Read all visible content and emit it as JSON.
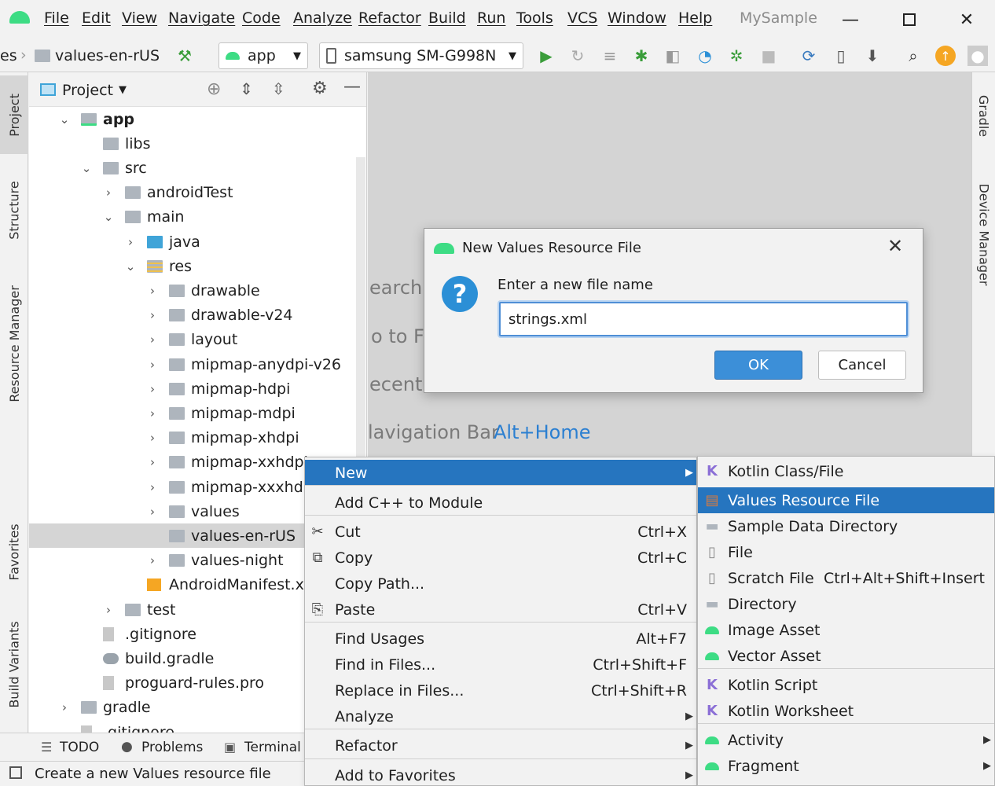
{
  "menu": [
    "File",
    "Edit",
    "View",
    "Navigate",
    "Code",
    "Analyze",
    "Refactor",
    "Build",
    "Run",
    "Tools",
    "VCS",
    "Window",
    "Help"
  ],
  "window_title": "MySample",
  "toolbar": {
    "breadcrumb_prefix": "es",
    "breadcrumb_folder": "values-en-rUS",
    "run_config": "app",
    "device": "samsung SM-G998N"
  },
  "left_tabs": [
    "Project",
    "Structure",
    "Resource Manager",
    "Favorites",
    "Build Variants"
  ],
  "right_tabs": [
    "Gradle",
    "Device Manager"
  ],
  "project_panel": {
    "title": "Project",
    "tree": [
      {
        "label": "app",
        "bold": true
      },
      {
        "label": "libs"
      },
      {
        "label": "src"
      },
      {
        "label": "androidTest"
      },
      {
        "label": "main"
      },
      {
        "label": "java"
      },
      {
        "label": "res"
      },
      {
        "label": "drawable"
      },
      {
        "label": "drawable-v24"
      },
      {
        "label": "layout"
      },
      {
        "label": "mipmap-anydpi-v26"
      },
      {
        "label": "mipmap-hdpi"
      },
      {
        "label": "mipmap-mdpi"
      },
      {
        "label": "mipmap-xhdpi"
      },
      {
        "label": "mipmap-xxhdpi"
      },
      {
        "label": "mipmap-xxxhdpi"
      },
      {
        "label": "values"
      },
      {
        "label": "values-en-rUS"
      },
      {
        "label": "values-night"
      },
      {
        "label": "AndroidManifest.xml"
      },
      {
        "label": "test"
      },
      {
        "label": ".gitignore"
      },
      {
        "label": "build.gradle"
      },
      {
        "label": "proguard-rules.pro"
      },
      {
        "label": "gradle"
      },
      {
        "label": ".gitignore"
      }
    ]
  },
  "editor_hints": [
    "earch",
    "o to F",
    "ecent",
    "lavigation Bar",
    "Alt+Home"
  ],
  "bottom_tools": [
    "TODO",
    "Problems",
    "Terminal"
  ],
  "status_text": "Create a new Values resource file",
  "dialog": {
    "title": "New Values Resource File",
    "prompt": "Enter a new file name",
    "input_value": "strings.xml",
    "ok": "OK",
    "cancel": "Cancel"
  },
  "context_menu": [
    {
      "label": "New",
      "shortcut": "",
      "submenu": true
    },
    {
      "label": "Add C++ to Module",
      "shortcut": ""
    },
    {
      "label": "Cut",
      "shortcut": "Ctrl+X"
    },
    {
      "label": "Copy",
      "shortcut": "Ctrl+C"
    },
    {
      "label": "Copy Path...",
      "shortcut": ""
    },
    {
      "label": "Paste",
      "shortcut": "Ctrl+V"
    },
    {
      "label": "Find Usages",
      "shortcut": "Alt+F7"
    },
    {
      "label": "Find in Files...",
      "shortcut": "Ctrl+Shift+F"
    },
    {
      "label": "Replace in Files...",
      "shortcut": "Ctrl+Shift+R"
    },
    {
      "label": "Analyze",
      "shortcut": "",
      "submenu": true
    },
    {
      "label": "Refactor",
      "shortcut": "",
      "submenu": true
    },
    {
      "label": "Add to Favorites",
      "shortcut": "",
      "submenu": true
    }
  ],
  "new_submenu": [
    {
      "label": "Kotlin Class/File",
      "shortcut": ""
    },
    {
      "label": "Values Resource File",
      "shortcut": ""
    },
    {
      "label": "Sample Data Directory",
      "shortcut": ""
    },
    {
      "label": "File",
      "shortcut": ""
    },
    {
      "label": "Scratch File",
      "shortcut": "Ctrl+Alt+Shift+Insert"
    },
    {
      "label": "Directory",
      "shortcut": ""
    },
    {
      "label": "Image Asset",
      "shortcut": ""
    },
    {
      "label": "Vector Asset",
      "shortcut": ""
    },
    {
      "label": "Kotlin Script",
      "shortcut": ""
    },
    {
      "label": "Kotlin Worksheet",
      "shortcut": ""
    },
    {
      "label": "Activity",
      "shortcut": ""
    },
    {
      "label": "Fragment",
      "shortcut": ""
    }
  ],
  "colors": {
    "selection": "#2675bf",
    "android_green": "#3ddc84",
    "question_blue": "#2b8fd6"
  }
}
